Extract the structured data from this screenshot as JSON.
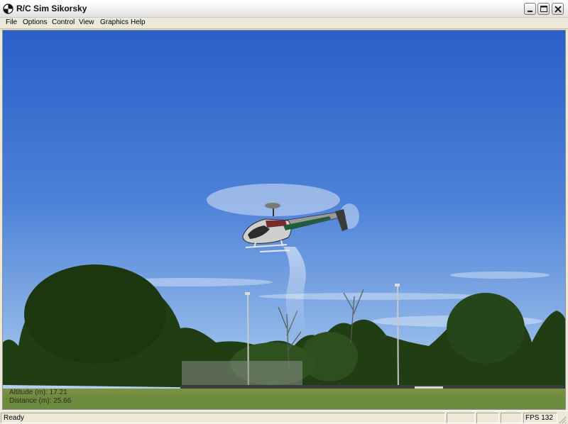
{
  "window": {
    "title": "R/C Sim Sikorsky",
    "buttons": [
      "minimize",
      "maximize",
      "close"
    ]
  },
  "menu": [
    "File",
    "Options",
    "Control",
    "View",
    "Graphics",
    "Help"
  ],
  "hud": {
    "altitude": "Altitude (m): 17.21",
    "distance": "Distance (m): 25.66"
  },
  "status": {
    "text": "Ready",
    "fps": "FPS 132"
  },
  "colors": {
    "sky_top": "#2d62c9",
    "sky_bottom": "#a9c8ee",
    "grass": "#6d8a3f",
    "trees": "#1f3d14"
  },
  "icons": [
    "app-icon",
    "minimize-icon",
    "maximize-icon",
    "close-icon",
    "resize-grip-icon"
  ]
}
